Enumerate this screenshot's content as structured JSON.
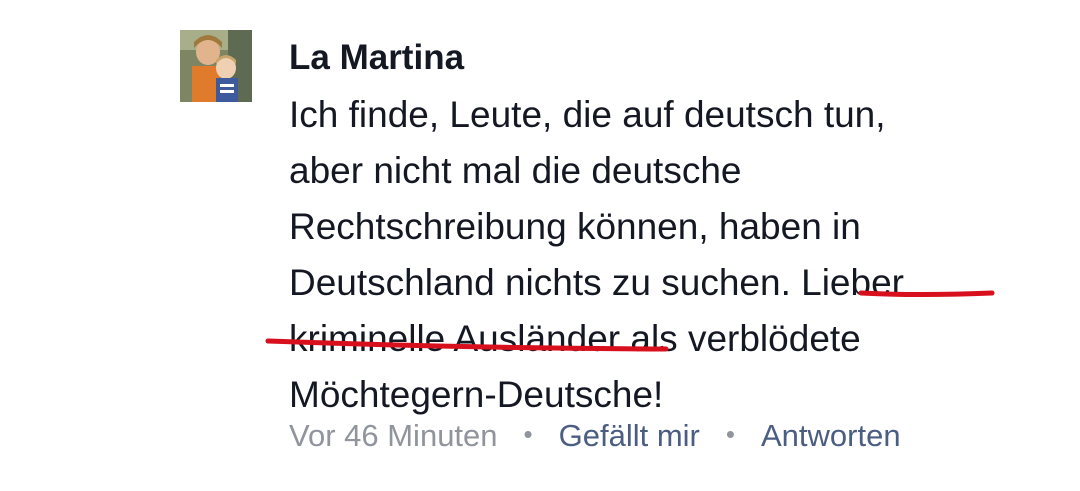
{
  "comment": {
    "author": "La Martina",
    "text_lines": [
      "Ich finde, Leute, die auf deutsch tun,",
      "aber nicht mal die deutsche",
      "Rechtschreibung können, haben in",
      "Deutschland nichts zu suchen. Lieber",
      "kriminelle Ausländer als verblödete",
      "Möchtegern-Deutsche!"
    ],
    "highlighted_phrase": "Lieber kriminelle Ausländer",
    "highlight_color": "#d8101e",
    "timestamp": "Vor 46 Minuten",
    "separator": "•",
    "like_label": "Gefällt mir",
    "reply_label": "Antworten",
    "avatar_icon": "user-photo-icon"
  },
  "colors": {
    "text": "#141823",
    "meta_grey": "#90949c",
    "link_blue": "#4b5e82"
  }
}
